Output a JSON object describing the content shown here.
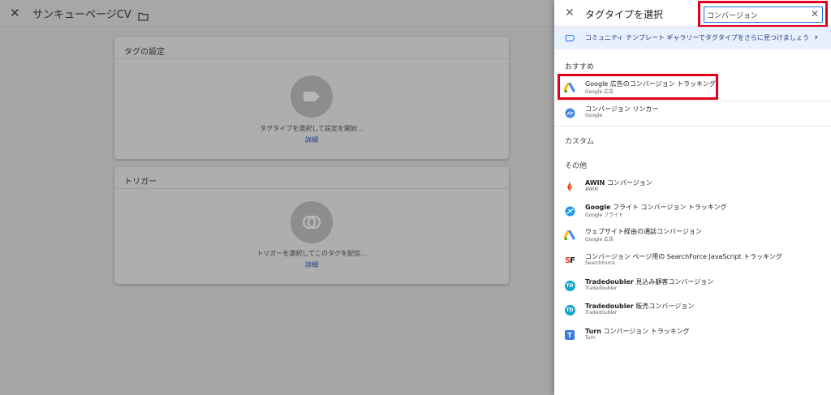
{
  "editor": {
    "close_icon": "close-icon",
    "title": "サンキューページCV",
    "folder_icon": "folder-icon",
    "tag_card": {
      "title": "タグの設定",
      "hint": "タグタイプを選択して設定を開始...",
      "link": "詳細"
    },
    "trigger_card": {
      "title": "トリガー",
      "hint": "トリガーを選択してこのタグを配信...",
      "link": "詳細"
    }
  },
  "panel": {
    "title": "タグタイプを選択",
    "search": {
      "value": "コンバージョン"
    },
    "banner": {
      "text": "コミュニティ テンプレート ギャラリーでタグタイプをさらに見つけましょう"
    },
    "sections": {
      "recommended": "おすすめ",
      "custom": "カスタム",
      "other": "その他"
    },
    "recommended_items": [
      {
        "name": "Google 広告のコンバージョン トラッキング",
        "vendor": "Google 広告",
        "icon": "google-ads-icon"
      },
      {
        "name": "コンバージョン リンカー",
        "vendor": "Google",
        "icon": "linker-icon"
      }
    ],
    "other_items": [
      {
        "name_bold": "AWIN",
        "name_rest": " コンバージョン",
        "vendor": "AWIN",
        "icon": "awin-icon"
      },
      {
        "name_bold": "Google",
        "name_rest": " フライト コンバージョン トラッキング",
        "vendor": "Google フライト",
        "icon": "flights-icon"
      },
      {
        "name_bold": "",
        "name_rest": "ウェブサイト経由の通話コンバージョン",
        "vendor": "Google 広告",
        "icon": "google-ads-icon"
      },
      {
        "name_bold": "",
        "name_rest": "コンバージョン ページ用の SearchForce JavaScript トラッキング",
        "vendor": "SearchForce",
        "icon": "searchforce-icon"
      },
      {
        "name_bold": "Tradedoubler",
        "name_rest": " 見込み顧客コンバージョン",
        "vendor": "Tradedoubler",
        "icon": "tradedoubler-icon"
      },
      {
        "name_bold": "Tradedoubler",
        "name_rest": " 販売コンバージョン",
        "vendor": "Tradedoubler",
        "icon": "tradedoubler-icon"
      },
      {
        "name_bold": "Turn",
        "name_rest": " コンバージョン トラッキング",
        "vendor": "Turn",
        "icon": "turn-icon"
      }
    ],
    "icon_labels": {
      "tradedoubler": "TD",
      "turn": "T",
      "sf_s": "S",
      "sf_f": "F"
    }
  },
  "colors": {
    "highlight": "#e0001b",
    "accent": "#1a73e8",
    "banner_bg": "#e8f0fe"
  }
}
